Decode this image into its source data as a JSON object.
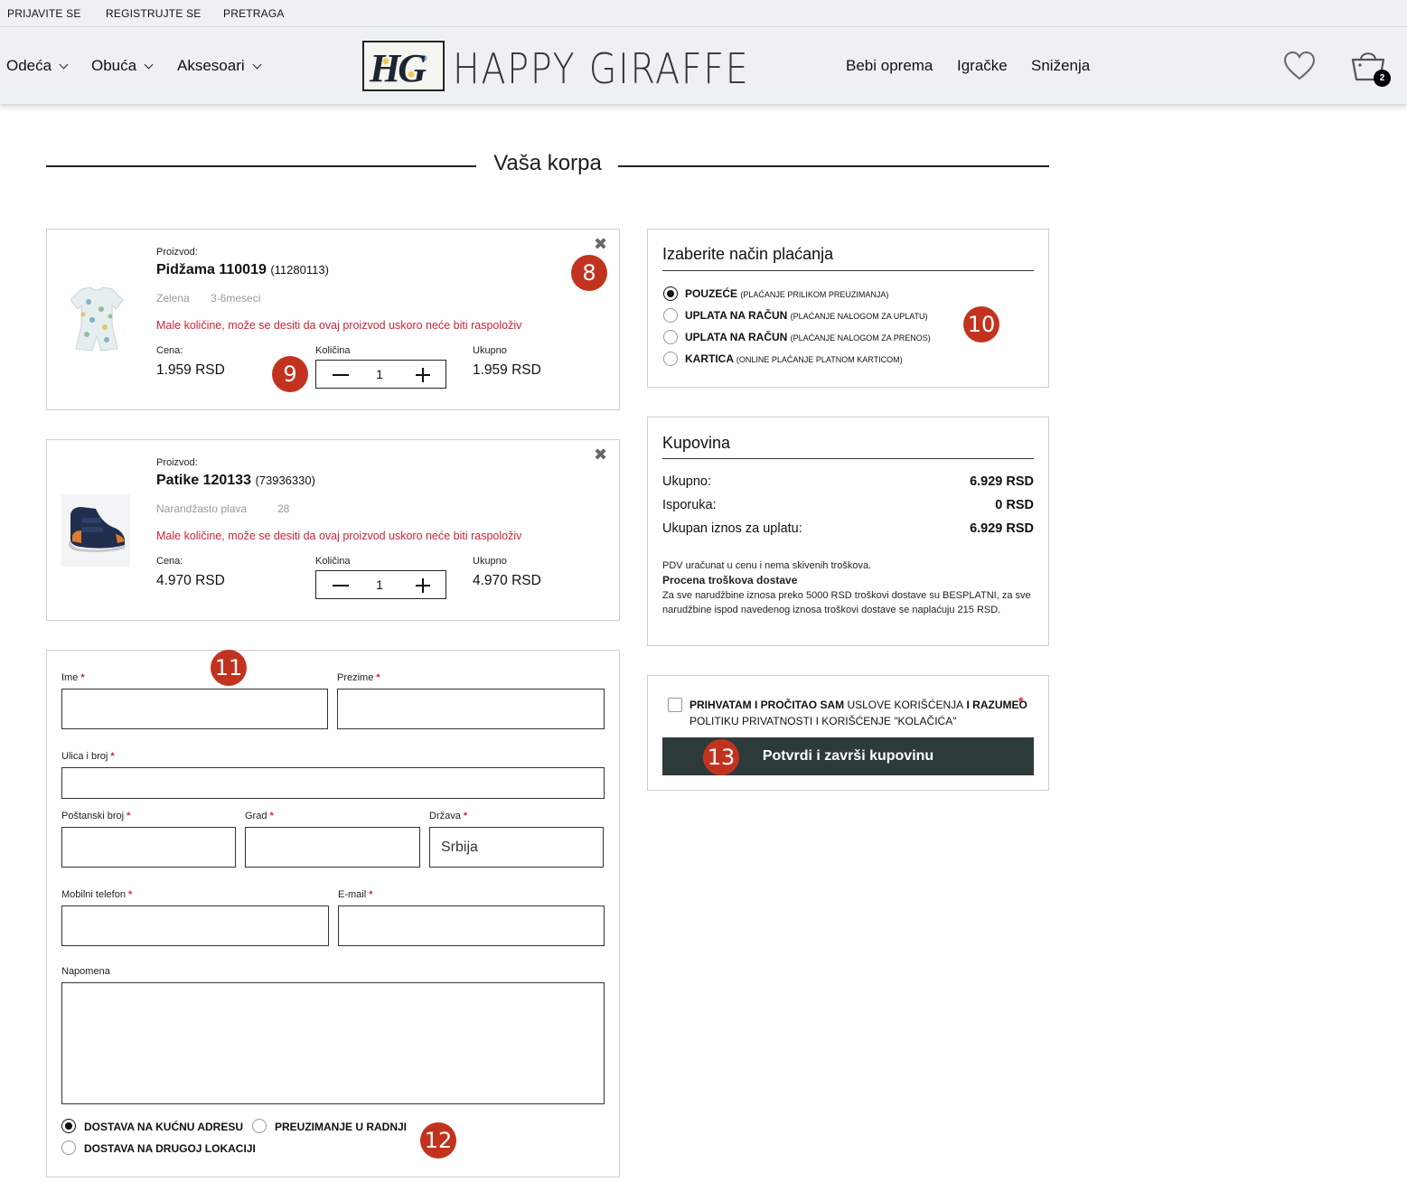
{
  "topbar": {
    "login": "PRIJAVITE SE",
    "register": "REGISTRUJTE SE",
    "search": "PRETRAGA"
  },
  "nav": {
    "left": [
      "Odeća",
      "Obuća",
      "Aksesoari"
    ],
    "right": [
      "Bebi oprema",
      "Igračke",
      "Sniženja"
    ],
    "logo_mark": "HG",
    "logo_text": "HAPPY GIRAFFE",
    "cart_count": "2"
  },
  "page": {
    "title": "Vaša korpa"
  },
  "cart": {
    "items": [
      {
        "product_label": "Proizvod:",
        "name": "Pidžama 110019",
        "code": "(11280113)",
        "color": "Zelena",
        "size": "3-6meseci",
        "warning": "Male količine, može se desiti da ovaj proizvod uskoro neće biti raspoloživ",
        "price_label": "Cena:",
        "price": "1.959 RSD",
        "qty_label": "Količina",
        "qty": "1",
        "total_label": "Ukupno",
        "total": "1.959 RSD"
      },
      {
        "product_label": "Proizvod:",
        "name": "Patike 120133",
        "code": "(73936330)",
        "color": "Narandžasto plava",
        "size": "28",
        "warning": "Male količine, može se desiti da ovaj proizvod uskoro neće biti raspoloživ",
        "price_label": "Cena:",
        "price": "4.970 RSD",
        "qty_label": "Količina",
        "qty": "1",
        "total_label": "Ukupno",
        "total": "4.970 RSD"
      }
    ]
  },
  "payment": {
    "title": "Izaberite način plaćanja",
    "options": [
      {
        "label": "POUZEĆE",
        "sub": "(PLAĆANJE PRILIKOM PREUZIMANJA)",
        "selected": true
      },
      {
        "label": "UPLATA NA RAČUN",
        "sub": "(PLAĆANJE NALOGOM ZA UPLATU)",
        "selected": false
      },
      {
        "label": "UPLATA NA RAČUN",
        "sub": "(PLAĆANJE NALOGOM ZA PRENOS)",
        "selected": false
      },
      {
        "label": "KARTICA",
        "sub": "(ONLINE PLAĆANJE PLATNOM KARTICOM)",
        "selected": false
      }
    ]
  },
  "summary": {
    "title": "Kupovina",
    "rows": [
      {
        "label": "Ukupno:",
        "value": "6.929 RSD"
      },
      {
        "label": "Isporuka:",
        "value": "0 RSD"
      },
      {
        "label": "Ukupan iznos za uplatu:",
        "value": "6.929 RSD"
      }
    ],
    "vat_note": "PDV uračunat u cenu i nema skivenih troškova.",
    "shipping_title": "Procena troškova dostave",
    "shipping_note": "Za sve narudžbine iznosa preko 5000 RSD troškovi dostave su BESPLATNI, za sve narudžbine ispod navedenog iznosa troškovi dostave se naplaćuju 215 RSD."
  },
  "terms": {
    "part1": "PRIHVATAM I PROČITAO SAM",
    "link1": "USLOVE KORIŠĆENJA",
    "part2": "I RAZUMEO",
    "link2": "POLITIKU PRIVATNOSTI I KORIŠĆENJE \"KOLAČIĆA\"",
    "required_mark": "*",
    "confirm": "Potvrdi i završi kupovinu"
  },
  "form": {
    "first_name": "Ime",
    "last_name": "Prezime",
    "street": "Ulica i broj",
    "postal": "Poštanski broj",
    "city": "Grad",
    "country": "Država",
    "country_value": "Srbija",
    "mobile": "Mobilni telefon",
    "email": "E-mail",
    "note": "Napomena",
    "required_mark": "*",
    "delivery": [
      {
        "label": "DOSTAVA NA KUĆNU ADRESU",
        "selected": true
      },
      {
        "label": "PREUZIMANJE U RADNJI",
        "selected": false
      },
      {
        "label": "DOSTAVA NA DRUGOJ LOKACIJI",
        "selected": false
      }
    ]
  },
  "annotations": [
    "8",
    "9",
    "10",
    "11",
    "12",
    "13"
  ]
}
